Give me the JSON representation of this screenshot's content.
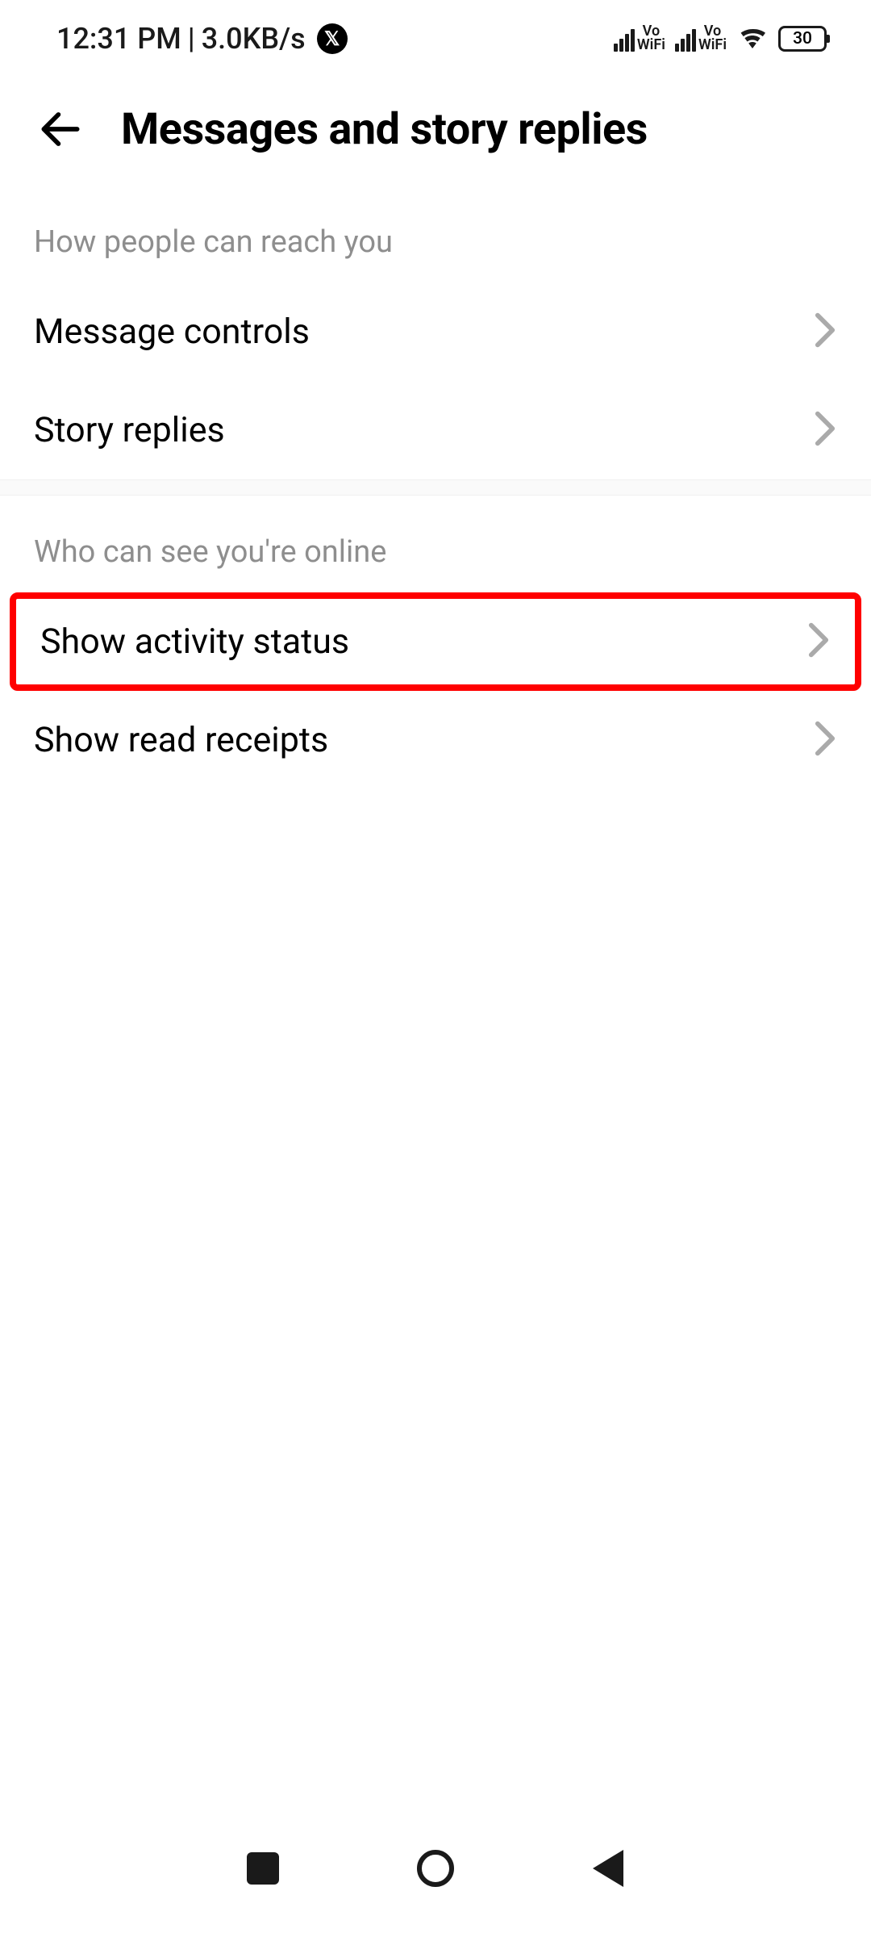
{
  "status_bar": {
    "time": "12:31 PM",
    "data_rate": "3.0KB/s",
    "battery_pct": "30",
    "vowifi_label": "Vo\nWiFi"
  },
  "header": {
    "title": "Messages and story replies"
  },
  "sections": {
    "reach": {
      "title": "How people can reach you",
      "items": {
        "message_controls": "Message controls",
        "story_replies": "Story replies"
      }
    },
    "online": {
      "title": "Who can see you're online",
      "items": {
        "activity_status": "Show activity status",
        "read_receipts": "Show read receipts"
      }
    }
  },
  "annotation": {
    "highlighted_item": "activity_status",
    "color": "#ff0000"
  }
}
